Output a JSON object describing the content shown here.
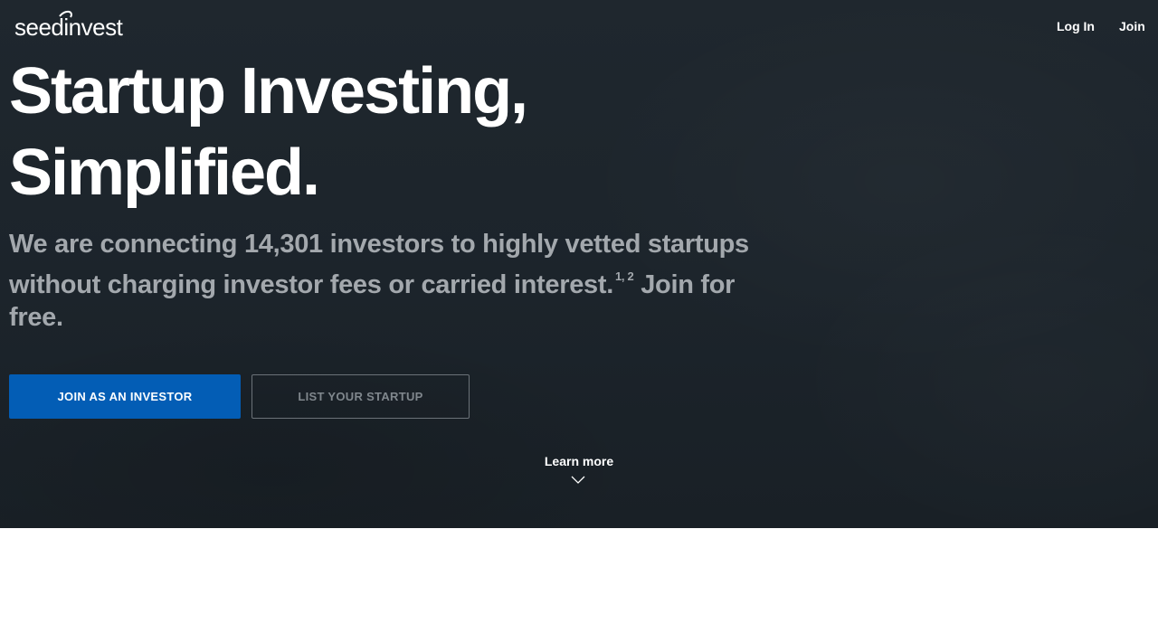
{
  "brand": {
    "name": "seedinvest"
  },
  "nav": {
    "login_label": "Log In",
    "join_label": "Join"
  },
  "hero": {
    "headline_line1": "Startup Investing,",
    "headline_line2": "Simplified.",
    "subtext_main": "We are connecting 14,301 investors to highly vetted startups without charging investor fees or carried interest.",
    "subtext_footnote": "1, 2",
    "subtext_end": " Join for free.",
    "primary_button": "JOIN AS AN INVESTOR",
    "secondary_button": "LIST YOUR STARTUP",
    "learn_more": "Learn more"
  },
  "icons": {
    "logo": "seedinvest-logo",
    "chevron": "chevron-down-icon"
  },
  "colors": {
    "hero_bg": "#1e262d",
    "primary": "#035db5",
    "subtext": "#a3a8ad",
    "secondary_text": "#80878d"
  }
}
